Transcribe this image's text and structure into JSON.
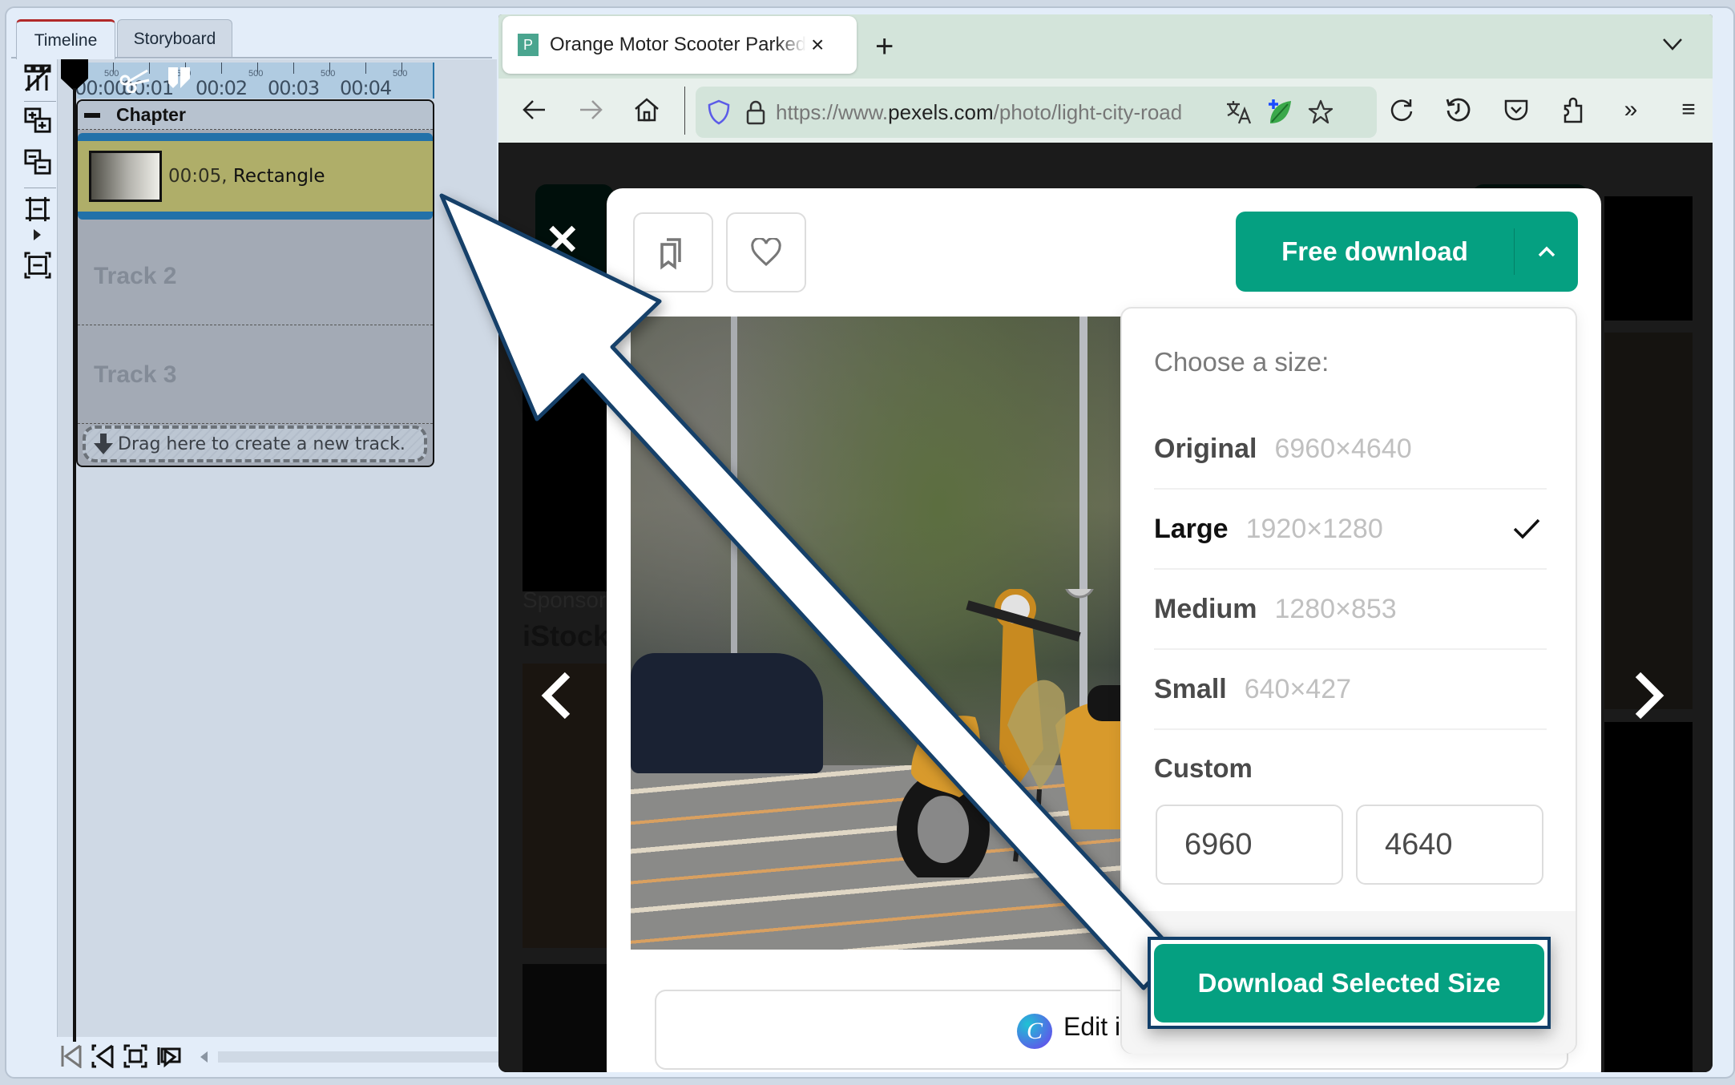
{
  "editor": {
    "tabs": [
      {
        "label": "Timeline",
        "active": true
      },
      {
        "label": "Storyboard",
        "active": false
      }
    ],
    "toolbar_icons": [
      "split-tracks-icon",
      "add-track-icon",
      "remove-track-icon",
      "expand-tracks-icon",
      "fit-tracks-icon"
    ],
    "ruler": {
      "labels": [
        "00:00",
        "00:01",
        "00:02",
        "00:03",
        "00:04"
      ],
      "sub_label": "500"
    },
    "chapter": {
      "title": "Chapter"
    },
    "clip": {
      "time": "00:05,",
      "name": "Rectangle"
    },
    "tracks": [
      {
        "label": "Track 2"
      },
      {
        "label": "Track 3"
      }
    ],
    "drop_zone": {
      "label": "Drag here to create a new track."
    },
    "bottom_tools": [
      "go-to-start-icon",
      "previous-marker-icon",
      "zoom-fit-icon",
      "preview-icon"
    ]
  },
  "browser": {
    "tab": {
      "favicon": "P",
      "title": "Orange Motor Scooter Parked on",
      "close": "×"
    },
    "new_tab": "+",
    "tab_list": "⌵",
    "url": {
      "prefix": "https://www.",
      "domain": "pexels.com",
      "path": "/photo/light-city-road"
    },
    "nav": {
      "back": "←",
      "forward": "→",
      "home": "⌂",
      "reload": "↻",
      "overflow": "»",
      "menu": "≡"
    }
  },
  "page": {
    "sponsored": "Sponsored",
    "istock": "iStock",
    "close": "✕",
    "prev": "‹",
    "next": "›"
  },
  "modal": {
    "free_download_label": "Free download",
    "edit_label": "Edit in",
    "canva_letter": "C",
    "size_menu": {
      "title": "Choose a size:",
      "options": [
        {
          "name": "Original",
          "dimensions": "6960×4640",
          "selected": false
        },
        {
          "name": "Large",
          "dimensions": "1920×1280",
          "selected": true
        },
        {
          "name": "Medium",
          "dimensions": "1280×853",
          "selected": false
        },
        {
          "name": "Small",
          "dimensions": "640×427",
          "selected": false
        }
      ],
      "custom_label": "Custom",
      "custom_width": "6960",
      "custom_height": "4640",
      "download_selected_label": "Download Selected Size"
    }
  },
  "colors": {
    "accent_green": "#05a081",
    "annotation_outline": "#123f69",
    "clip_fill": "#afae69",
    "clip_border": "#2271a9"
  }
}
